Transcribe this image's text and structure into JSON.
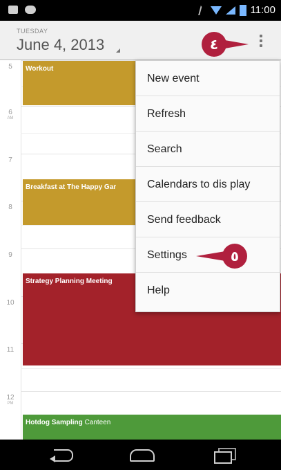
{
  "status_bar": {
    "time": "11:00"
  },
  "header": {
    "day_of_week": "TUESDAY",
    "date": "June 4, 2013"
  },
  "callouts": {
    "overflow_step": "٤",
    "settings_step": "٥"
  },
  "hours": [
    {
      "label": "5",
      "ampm": ""
    },
    {
      "label": "6",
      "ampm": "AM"
    },
    {
      "label": "7",
      "ampm": ""
    },
    {
      "label": "8",
      "ampm": ""
    },
    {
      "label": "9",
      "ampm": ""
    },
    {
      "label": "10",
      "ampm": ""
    },
    {
      "label": "11",
      "ampm": ""
    },
    {
      "label": "12",
      "ampm": "PM"
    }
  ],
  "events": [
    {
      "title": "Workout",
      "location": "",
      "color": "#c49a2c"
    },
    {
      "title": "Breakfast at The Happy Gar",
      "location": "",
      "color": "#c49a2c"
    },
    {
      "title": "Strategy Planning Meeting",
      "location": "",
      "color": "#a3222a"
    },
    {
      "title": "Hotdog Sampling",
      "location": "Canteen",
      "color": "#4e9a3a"
    }
  ],
  "menu": {
    "items": [
      "New event",
      "Refresh",
      "Search",
      "Calendars to dis play",
      "Send feedback",
      "Settings",
      "Help"
    ]
  },
  "colors": {
    "accent_callout": "#b0203e",
    "event_gold": "#c49a2c",
    "event_red": "#a3222a",
    "event_green": "#4e9a3a"
  },
  "nav_icons": [
    "back-icon",
    "home-icon",
    "recent-apps-icon"
  ]
}
